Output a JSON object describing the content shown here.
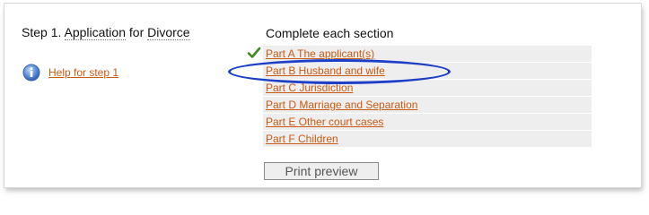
{
  "step": {
    "prefix": "Step 1.",
    "word_application": "Application",
    "word_for": "for",
    "word_divorce": "Divorce"
  },
  "help": {
    "icon": "info-icon",
    "link_text": "Help for step 1"
  },
  "sections": {
    "heading": "Complete each section",
    "completed_icon": "checkmark-icon",
    "items": [
      {
        "label": "Part A The applicant(s)",
        "completed": true
      },
      {
        "label": "Part B Husband and wife",
        "completed": false,
        "highlighted": true
      },
      {
        "label": "Part C Jurisdiction",
        "completed": false
      },
      {
        "label": "Part D Marriage and Separation",
        "completed": false
      },
      {
        "label": "Part E Other court cases",
        "completed": false
      },
      {
        "label": "Part F Children",
        "completed": false
      }
    ]
  },
  "actions": {
    "print_preview_label": "Print preview"
  },
  "colors": {
    "link": "#c85a14",
    "row_background": "#eeeeee",
    "highlight_outline": "#1d3fc7",
    "check": "#3f8a1e"
  }
}
